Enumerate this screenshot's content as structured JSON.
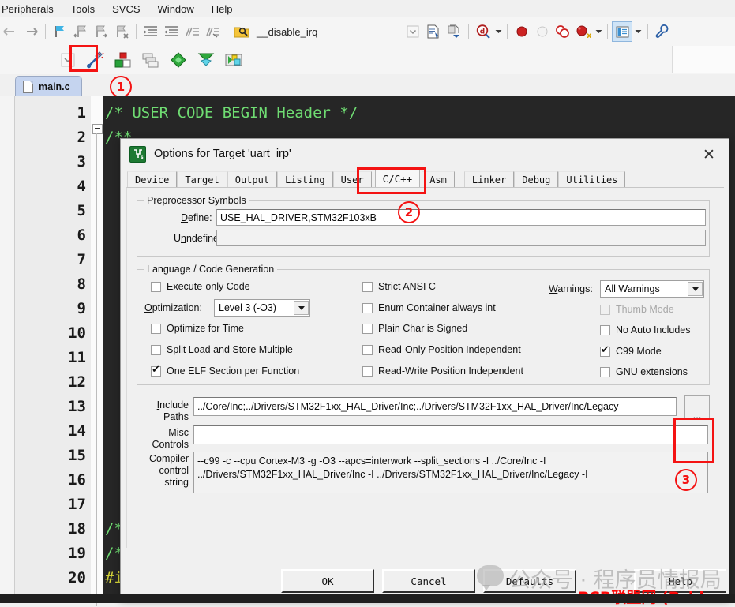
{
  "menubar": {
    "items": [
      {
        "label": "Peripherals"
      },
      {
        "label": "Tools"
      },
      {
        "label": "SVCS"
      },
      {
        "label": "Window"
      },
      {
        "label": "Help"
      }
    ]
  },
  "toolbar": {
    "target_name": "__disable_irq",
    "icons_row1": [
      "back-arrow-icon",
      "forward-arrow-icon",
      "bookmark-icon",
      "bookmark-prev-icon",
      "bookmark-next-icon",
      "bookmark-clear-icon",
      "indent-icon",
      "outdent-icon",
      "comment-icon",
      "uncomment-icon",
      "find-in-files-icon"
    ],
    "icons_row1b": [
      "dropdown-arrow-icon",
      "insert-file-icon",
      "debug-step-icon",
      "magnifier-icon",
      "breakpoint-icon",
      "breakpoint-disabled-icon",
      "breakpoint-toggle-icon",
      "breakpoint-kill-icon",
      "window-panel-icon",
      "configure-icon"
    ],
    "icons_row2": [
      "dropdown-arrow-icon",
      "target-options-wand-icon",
      "build-target-icon",
      "batch-build-icon",
      "manage-components-icon",
      "pack-installer-icon",
      "multi-project-icon"
    ]
  },
  "editor": {
    "tab_label": "main.c",
    "tab_icon": "document-icon",
    "line_numbers": [
      "1",
      "2",
      "3",
      "4",
      "5",
      "6",
      "7",
      "8",
      "9",
      "10",
      "11",
      "12",
      "13",
      "14",
      "15",
      "16",
      "17",
      "18",
      "19",
      "20"
    ],
    "lines": [
      {
        "text": "/* USER CODE BEGIN Header */",
        "type": "comment"
      },
      {
        "text": "/**",
        "type": "comment"
      },
      {
        "text": "  *",
        "type": "comment"
      },
      {
        "text": "  *",
        "type": "comment"
      },
      {
        "text": "  *",
        "type": "comment"
      },
      {
        "text": "  *",
        "type": "comment"
      },
      {
        "text": "  *",
        "type": "comment"
      },
      {
        "text": "  *",
        "type": "comment"
      },
      {
        "text": "  *",
        "type": "comment"
      },
      {
        "text": "  *",
        "type": "comment"
      },
      {
        "text": "  *",
        "type": "comment"
      },
      {
        "text": "  *",
        "type": "comment"
      },
      {
        "text": "  *",
        "type": "comment"
      },
      {
        "text": "  *",
        "type": "comment"
      },
      {
        "text": "  *",
        "type": "comment"
      },
      {
        "text": "  *",
        "type": "comment"
      },
      {
        "text": "  *",
        "type": "comment"
      },
      {
        "text": "/*",
        "type": "comment"
      },
      {
        "text": "/*",
        "type": "comment"
      },
      {
        "text": "#i",
        "type": "pre"
      }
    ]
  },
  "dialog": {
    "title": "Options for Target 'uart_irp'",
    "title_icon": "keil-uvision-icon",
    "close_icon": "close-icon",
    "tabs": [
      {
        "label": "Device",
        "active": false
      },
      {
        "label": "Target",
        "active": false
      },
      {
        "label": "Output",
        "active": false
      },
      {
        "label": "Listing",
        "active": false
      },
      {
        "label": "User",
        "active": false
      },
      {
        "label": "C/C++",
        "active": true
      },
      {
        "label": "Asm",
        "active": false
      },
      {
        "label": "Linker",
        "active": false
      },
      {
        "label": "Debug",
        "active": false
      },
      {
        "label": "Utilities",
        "active": false
      }
    ],
    "preprocessor": {
      "legend": "Preprocessor Symbols",
      "define_label": "Define:",
      "define_value": "USE_HAL_DRIVER,STM32F103xB",
      "undefine_label": "Undefine:",
      "undefine_value": ""
    },
    "language": {
      "legend": "Language / Code Generation",
      "col1": [
        {
          "label": "Execute-only Code",
          "checked": false,
          "disabled": false
        },
        {
          "label": "Optimize for Time",
          "checked": false,
          "disabled": false
        },
        {
          "label": "Split Load and Store Multiple",
          "checked": false,
          "disabled": false
        },
        {
          "label": "One ELF Section per Function",
          "checked": true,
          "disabled": false
        }
      ],
      "optimization_label": "Optimization:",
      "optimization_value": "Level 3 (-O3)",
      "col2": [
        {
          "label": "Strict ANSI C",
          "checked": false,
          "disabled": false
        },
        {
          "label": "Enum Container always int",
          "checked": false,
          "disabled": false
        },
        {
          "label": "Plain Char is Signed",
          "checked": false,
          "disabled": false
        },
        {
          "label": "Read-Only Position Independent",
          "checked": false,
          "disabled": false
        },
        {
          "label": "Read-Write Position Independent",
          "checked": false,
          "disabled": false
        }
      ],
      "warnings_label": "Warnings:",
      "warnings_value": "All Warnings",
      "col3": [
        {
          "label": "Thumb Mode",
          "checked": false,
          "disabled": true
        },
        {
          "label": "No Auto Includes",
          "checked": false,
          "disabled": false
        },
        {
          "label": "C99 Mode",
          "checked": true,
          "disabled": false
        },
        {
          "label": "GNU extensions",
          "checked": false,
          "disabled": false
        }
      ]
    },
    "paths": {
      "include_label_l1": "Include",
      "include_label_l2": "Paths",
      "include_value": "../Core/Inc;../Drivers/STM32F1xx_HAL_Driver/Inc;../Drivers/STM32F1xx_HAL_Driver/Inc/Legacy",
      "browse_button": "...",
      "misc_label_l1": "Misc",
      "misc_label_l2": "Controls",
      "misc_value": "",
      "compiler_label_l1": "Compiler",
      "compiler_label_l2": "control",
      "compiler_label_l3": "string",
      "compiler_value_line1": "--c99 -c --cpu Cortex-M3 -g -O3 --apcs=interwork --split_sections -I ../Core/Inc -I",
      "compiler_value_line2": "../Drivers/STM32F1xx_HAL_Driver/Inc -I ../Drivers/STM32F1xx_HAL_Driver/Inc/Legacy -I"
    },
    "buttons": {
      "ok": "OK",
      "cancel": "Cancel",
      "defaults": "Defaults",
      "help": "Help"
    }
  },
  "annotations": {
    "marker1": "①",
    "marker2": "②",
    "marker3": "③",
    "highlight_color": "#f41313"
  },
  "watermarks": {
    "gray_text": "公众号 · 程序员情报局",
    "red_text": "PCB联盟网 (Pcbbar.com)"
  }
}
